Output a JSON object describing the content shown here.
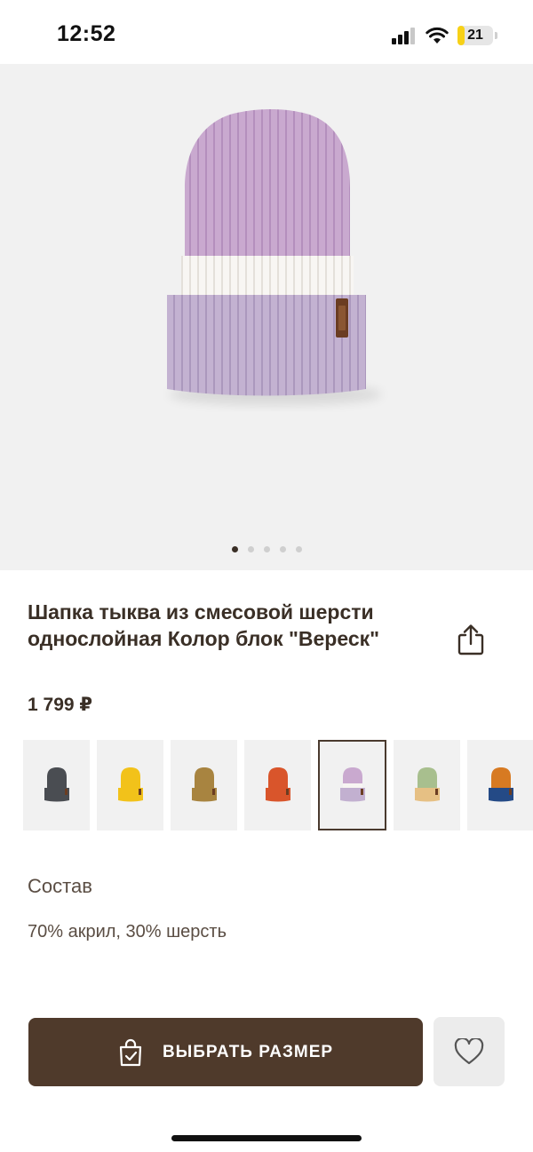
{
  "status_bar": {
    "time": "12:52",
    "icons": [
      "signal-icon",
      "wifi-icon",
      "battery-icon"
    ],
    "battery_level": "21",
    "battery_color": "#f7d117"
  },
  "gallery": {
    "image_icon": "hat-image",
    "image_colors": {
      "crown": "#c9a9cf",
      "stripe": "#f7f5f2",
      "cuff": "#c2b0d0",
      "patch": "#6b3d22"
    },
    "page_count": 5,
    "active_page": 1
  },
  "product": {
    "title": "Шапка тыква из смесовой шерсти однослойная Колор блок \"Вереск\"",
    "price": "1 799 ₽",
    "share_icon": "share-icon"
  },
  "variants": {
    "selected_index": 4,
    "items": [
      {
        "name": "variant-graphite",
        "colors": [
          "#4a4d52",
          "#4a4d52"
        ]
      },
      {
        "name": "variant-yellow",
        "colors": [
          "#f2c21a",
          "#f2c21a"
        ]
      },
      {
        "name": "variant-mustard",
        "colors": [
          "#a88440",
          "#a88440"
        ]
      },
      {
        "name": "variant-terracotta",
        "colors": [
          "#d9552b",
          "#d9552b"
        ]
      },
      {
        "name": "variant-heather",
        "colors": [
          "#c9a9cf",
          "#c2b0d0"
        ]
      },
      {
        "name": "variant-sage",
        "colors": [
          "#a8bf8e",
          "#e6c084"
        ]
      },
      {
        "name": "variant-rust-navy",
        "colors": [
          "#d77a22",
          "#244a86"
        ]
      }
    ]
  },
  "composition": {
    "heading": "Состав",
    "value": "70% акрил, 30% шерсть"
  },
  "actions": {
    "select_size_label": "ВЫБРАТЬ РАЗМЕР",
    "select_size_icon": "shopping-bag-check-icon",
    "favorite_icon": "heart-icon",
    "primary_color": "#4f3a2b"
  }
}
